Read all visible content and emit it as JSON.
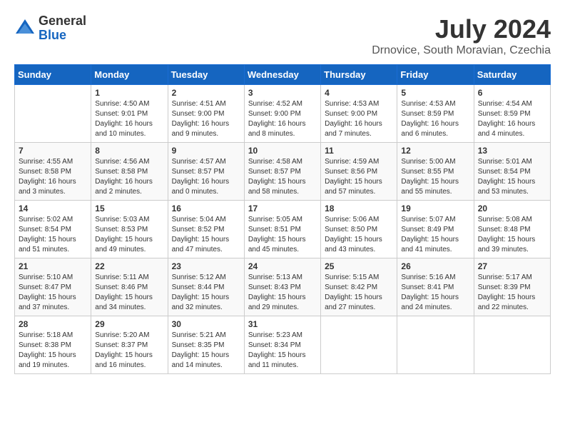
{
  "header": {
    "logo_general": "General",
    "logo_blue": "Blue",
    "month_title": "July 2024",
    "location": "Drnovice, South Moravian, Czechia"
  },
  "calendar": {
    "days_of_week": [
      "Sunday",
      "Monday",
      "Tuesday",
      "Wednesday",
      "Thursday",
      "Friday",
      "Saturday"
    ],
    "weeks": [
      [
        {
          "day": "",
          "info": ""
        },
        {
          "day": "1",
          "info": "Sunrise: 4:50 AM\nSunset: 9:01 PM\nDaylight: 16 hours\nand 10 minutes."
        },
        {
          "day": "2",
          "info": "Sunrise: 4:51 AM\nSunset: 9:00 PM\nDaylight: 16 hours\nand 9 minutes."
        },
        {
          "day": "3",
          "info": "Sunrise: 4:52 AM\nSunset: 9:00 PM\nDaylight: 16 hours\nand 8 minutes."
        },
        {
          "day": "4",
          "info": "Sunrise: 4:53 AM\nSunset: 9:00 PM\nDaylight: 16 hours\nand 7 minutes."
        },
        {
          "day": "5",
          "info": "Sunrise: 4:53 AM\nSunset: 8:59 PM\nDaylight: 16 hours\nand 6 minutes."
        },
        {
          "day": "6",
          "info": "Sunrise: 4:54 AM\nSunset: 8:59 PM\nDaylight: 16 hours\nand 4 minutes."
        }
      ],
      [
        {
          "day": "7",
          "info": "Sunrise: 4:55 AM\nSunset: 8:58 PM\nDaylight: 16 hours\nand 3 minutes."
        },
        {
          "day": "8",
          "info": "Sunrise: 4:56 AM\nSunset: 8:58 PM\nDaylight: 16 hours\nand 2 minutes."
        },
        {
          "day": "9",
          "info": "Sunrise: 4:57 AM\nSunset: 8:57 PM\nDaylight: 16 hours\nand 0 minutes."
        },
        {
          "day": "10",
          "info": "Sunrise: 4:58 AM\nSunset: 8:57 PM\nDaylight: 15 hours\nand 58 minutes."
        },
        {
          "day": "11",
          "info": "Sunrise: 4:59 AM\nSunset: 8:56 PM\nDaylight: 15 hours\nand 57 minutes."
        },
        {
          "day": "12",
          "info": "Sunrise: 5:00 AM\nSunset: 8:55 PM\nDaylight: 15 hours\nand 55 minutes."
        },
        {
          "day": "13",
          "info": "Sunrise: 5:01 AM\nSunset: 8:54 PM\nDaylight: 15 hours\nand 53 minutes."
        }
      ],
      [
        {
          "day": "14",
          "info": "Sunrise: 5:02 AM\nSunset: 8:54 PM\nDaylight: 15 hours\nand 51 minutes."
        },
        {
          "day": "15",
          "info": "Sunrise: 5:03 AM\nSunset: 8:53 PM\nDaylight: 15 hours\nand 49 minutes."
        },
        {
          "day": "16",
          "info": "Sunrise: 5:04 AM\nSunset: 8:52 PM\nDaylight: 15 hours\nand 47 minutes."
        },
        {
          "day": "17",
          "info": "Sunrise: 5:05 AM\nSunset: 8:51 PM\nDaylight: 15 hours\nand 45 minutes."
        },
        {
          "day": "18",
          "info": "Sunrise: 5:06 AM\nSunset: 8:50 PM\nDaylight: 15 hours\nand 43 minutes."
        },
        {
          "day": "19",
          "info": "Sunrise: 5:07 AM\nSunset: 8:49 PM\nDaylight: 15 hours\nand 41 minutes."
        },
        {
          "day": "20",
          "info": "Sunrise: 5:08 AM\nSunset: 8:48 PM\nDaylight: 15 hours\nand 39 minutes."
        }
      ],
      [
        {
          "day": "21",
          "info": "Sunrise: 5:10 AM\nSunset: 8:47 PM\nDaylight: 15 hours\nand 37 minutes."
        },
        {
          "day": "22",
          "info": "Sunrise: 5:11 AM\nSunset: 8:46 PM\nDaylight: 15 hours\nand 34 minutes."
        },
        {
          "day": "23",
          "info": "Sunrise: 5:12 AM\nSunset: 8:44 PM\nDaylight: 15 hours\nand 32 minutes."
        },
        {
          "day": "24",
          "info": "Sunrise: 5:13 AM\nSunset: 8:43 PM\nDaylight: 15 hours\nand 29 minutes."
        },
        {
          "day": "25",
          "info": "Sunrise: 5:15 AM\nSunset: 8:42 PM\nDaylight: 15 hours\nand 27 minutes."
        },
        {
          "day": "26",
          "info": "Sunrise: 5:16 AM\nSunset: 8:41 PM\nDaylight: 15 hours\nand 24 minutes."
        },
        {
          "day": "27",
          "info": "Sunrise: 5:17 AM\nSunset: 8:39 PM\nDaylight: 15 hours\nand 22 minutes."
        }
      ],
      [
        {
          "day": "28",
          "info": "Sunrise: 5:18 AM\nSunset: 8:38 PM\nDaylight: 15 hours\nand 19 minutes."
        },
        {
          "day": "29",
          "info": "Sunrise: 5:20 AM\nSunset: 8:37 PM\nDaylight: 15 hours\nand 16 minutes."
        },
        {
          "day": "30",
          "info": "Sunrise: 5:21 AM\nSunset: 8:35 PM\nDaylight: 15 hours\nand 14 minutes."
        },
        {
          "day": "31",
          "info": "Sunrise: 5:23 AM\nSunset: 8:34 PM\nDaylight: 15 hours\nand 11 minutes."
        },
        {
          "day": "",
          "info": ""
        },
        {
          "day": "",
          "info": ""
        },
        {
          "day": "",
          "info": ""
        }
      ]
    ]
  }
}
